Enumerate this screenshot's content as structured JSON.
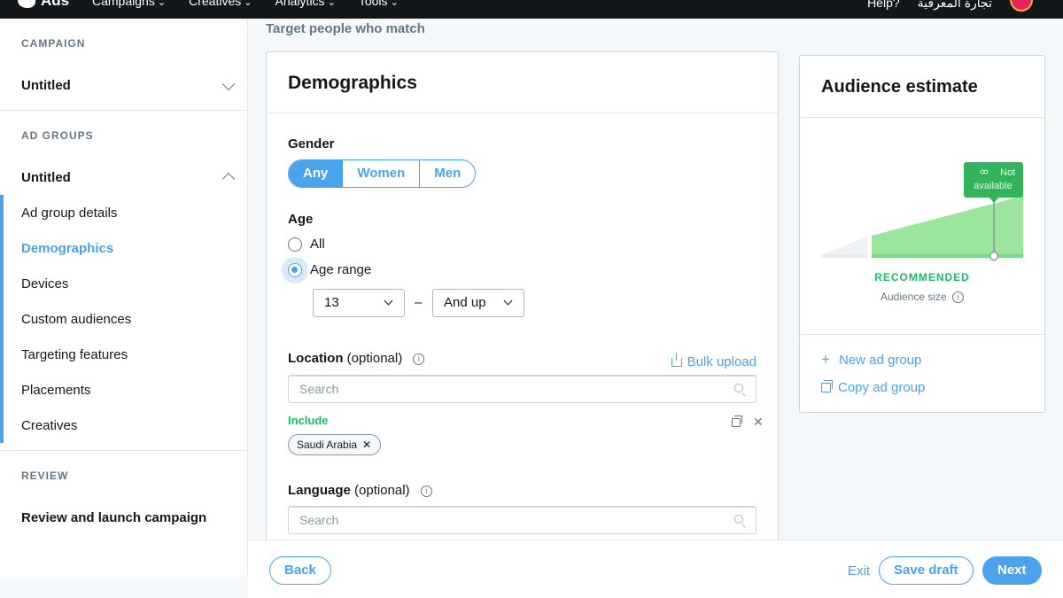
{
  "topnav": {
    "logo": "Ads",
    "menu": [
      "Campaigns",
      "Creatives",
      "Analytics",
      "Tools"
    ],
    "help": "Help?",
    "account": "تجارة المعرفية"
  },
  "sidebar": {
    "campaign_label": "CAMPAIGN",
    "campaign_name": "Untitled",
    "ad_groups_label": "AD GROUPS",
    "ad_group_name": "Untitled",
    "items": [
      {
        "label": "Ad group details"
      },
      {
        "label": "Demographics"
      },
      {
        "label": "Devices"
      },
      {
        "label": "Custom audiences"
      },
      {
        "label": "Targeting features"
      },
      {
        "label": "Placements"
      },
      {
        "label": "Creatives"
      }
    ],
    "review_label": "REVIEW",
    "review_item": "Review and launch campaign"
  },
  "main": {
    "heading": "Target people who match",
    "card_title": "Demographics",
    "gender": {
      "label": "Gender",
      "options": [
        "Any",
        "Women",
        "Men"
      ],
      "selected": "Any"
    },
    "age": {
      "label": "Age",
      "option_all": "All",
      "option_range": "Age range",
      "from": "13",
      "to": "And up",
      "separator": "–"
    },
    "location": {
      "label": "Location",
      "optional": "(optional)",
      "bulk_upload": "Bulk upload",
      "placeholder": "Search",
      "include_label": "Include",
      "chips": [
        "Saudi Arabia"
      ]
    },
    "language": {
      "label": "Language",
      "optional": "(optional)",
      "placeholder": "Search"
    }
  },
  "audience": {
    "title": "Audience estimate",
    "status": "Not available",
    "recommended": "RECOMMENDED",
    "size_label": "Audience size",
    "new_ad_group": "New ad group",
    "copy_ad_group": "Copy ad group",
    "colors": {
      "recommended": "#17bf63",
      "range_fill": "#9be59f",
      "badge": "#32b45a"
    }
  },
  "footer": {
    "back": "Back",
    "exit": "Exit",
    "save_draft": "Save draft",
    "next": "Next"
  },
  "colors": {
    "accent": "#4ba3eb",
    "topnav": "#14171a"
  }
}
